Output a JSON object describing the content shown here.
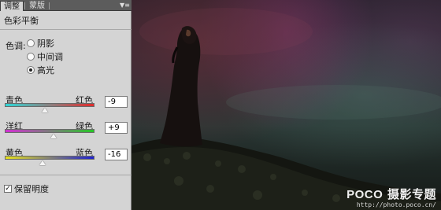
{
  "tabs": [
    {
      "label": "调整",
      "active": true
    },
    {
      "label": "蒙版",
      "active": false
    }
  ],
  "panel": {
    "title": "色彩平衡",
    "tone_label": "色调:",
    "tones": [
      {
        "label": "阴影",
        "checked": false
      },
      {
        "label": "中间调",
        "checked": false
      },
      {
        "label": "高光",
        "checked": true
      }
    ],
    "sliders": [
      {
        "left": "青色",
        "right": "红色",
        "value": "-9",
        "position": 0.45
      },
      {
        "left": "洋红",
        "right": "绿色",
        "value": "+9",
        "position": 0.545
      },
      {
        "left": "黄色",
        "right": "蓝色",
        "value": "-16",
        "position": 0.42
      }
    ],
    "preserve_luminosity": {
      "label": "保留明度",
      "checked": true
    },
    "menu_icon": "panel-menu-icon"
  },
  "watermark": {
    "brand": "POCO",
    "title": "摄影专题",
    "url": "http://photo.poco.cn/"
  },
  "colors": {
    "panel_bg": "#d4d4d4",
    "tab_bar": "#5c5c5c"
  }
}
